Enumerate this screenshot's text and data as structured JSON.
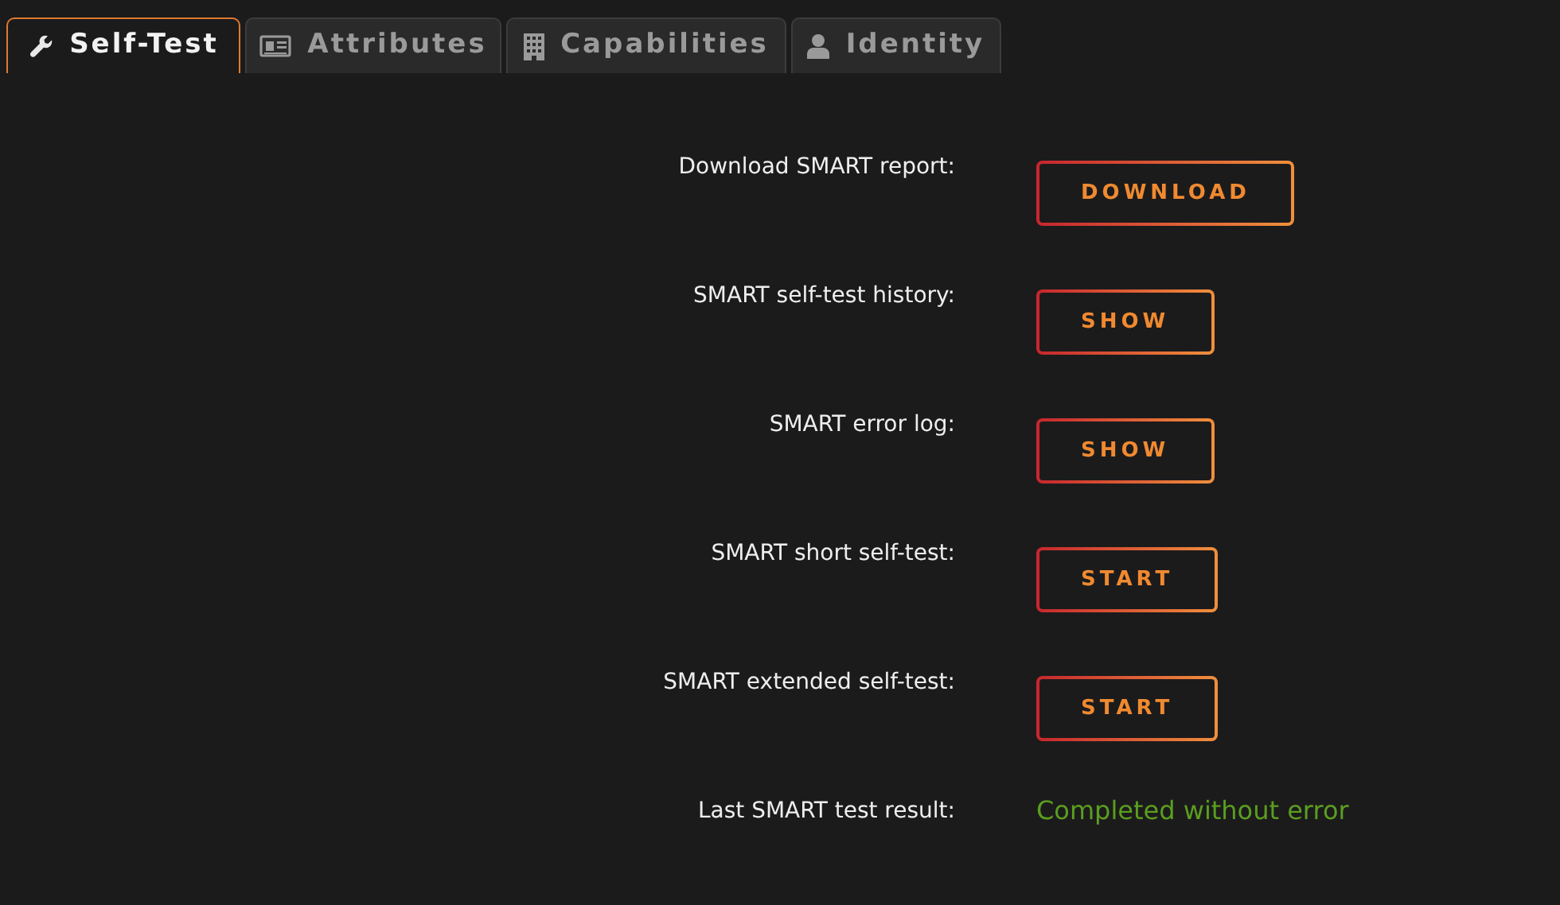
{
  "tabs": [
    {
      "label": "Self-Test",
      "kind": "wrench",
      "selected": true
    },
    {
      "label": "Attributes",
      "kind": "card",
      "selected": false
    },
    {
      "label": "Capabilities",
      "kind": "building",
      "selected": false
    },
    {
      "label": "Identity",
      "kind": "user",
      "selected": false
    }
  ],
  "rows": [
    {
      "kind": "button",
      "label": "Download SMART report:",
      "button": "DOWNLOAD"
    },
    {
      "kind": "button",
      "label": "SMART self-test history:",
      "button": "SHOW"
    },
    {
      "kind": "button",
      "label": "SMART error log:",
      "button": "SHOW"
    },
    {
      "kind": "button",
      "label": "SMART short self-test:",
      "button": "START"
    },
    {
      "kind": "button",
      "label": "SMART extended self-test:",
      "button": "START"
    },
    {
      "kind": "status",
      "label": "Last SMART test result:",
      "value": "Completed without error",
      "color": "#5a9e1f"
    }
  ]
}
